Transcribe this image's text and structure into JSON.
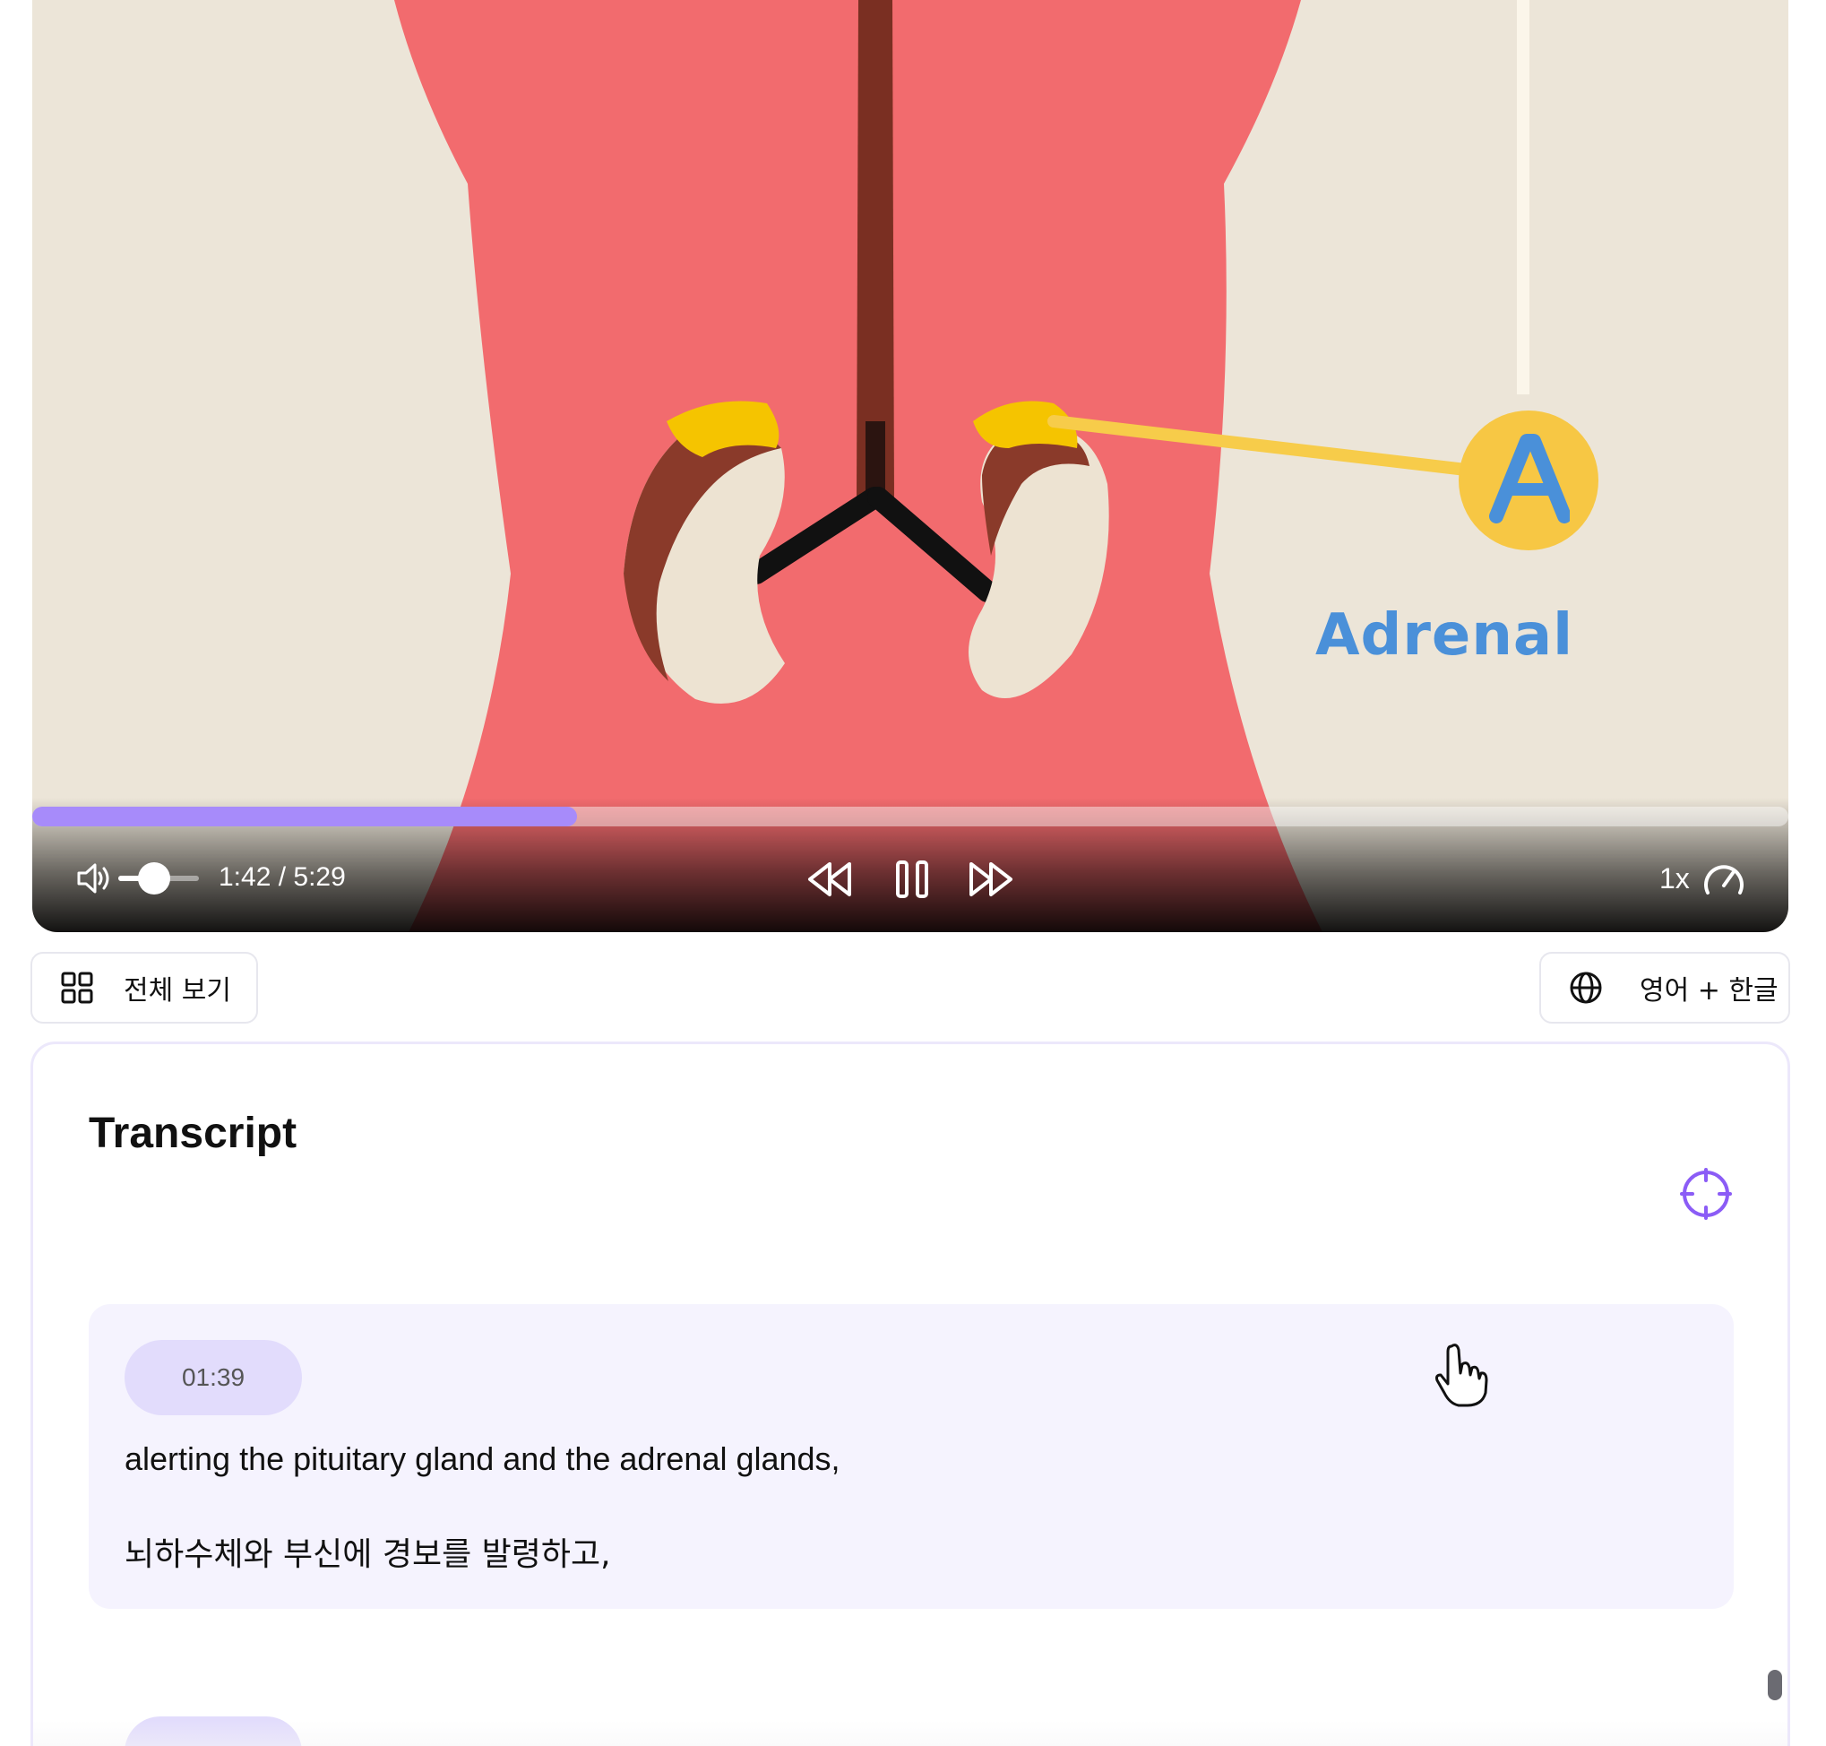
{
  "player": {
    "overlay_label": "Adrenal",
    "marker_letter": "A",
    "progress_fraction": 0.31,
    "volume_fraction": 0.48,
    "time_display": "1:42 / 5:29",
    "speed_label": "1x",
    "accent_color": "#a78bfa",
    "controls": {
      "volume_icon": "volume-icon",
      "rewind_icon": "rewind-icon",
      "pause_icon": "pause-icon",
      "forward_icon": "fast-forward-icon",
      "speed_icon": "speedometer-icon"
    }
  },
  "toolbar": {
    "view_all_label": "전체 보기",
    "view_all_icon": "grid-icon",
    "language_label": "영어 + 한글",
    "language_icon": "globe-icon"
  },
  "transcript": {
    "title": "Transcript",
    "locate_icon": "crosshair-icon",
    "entries": [
      {
        "time": "01:39",
        "english": "alerting the pituitary gland and the adrenal glands,",
        "korean": "뇌하수체와 부신에 경보를 발령하고,"
      }
    ]
  }
}
